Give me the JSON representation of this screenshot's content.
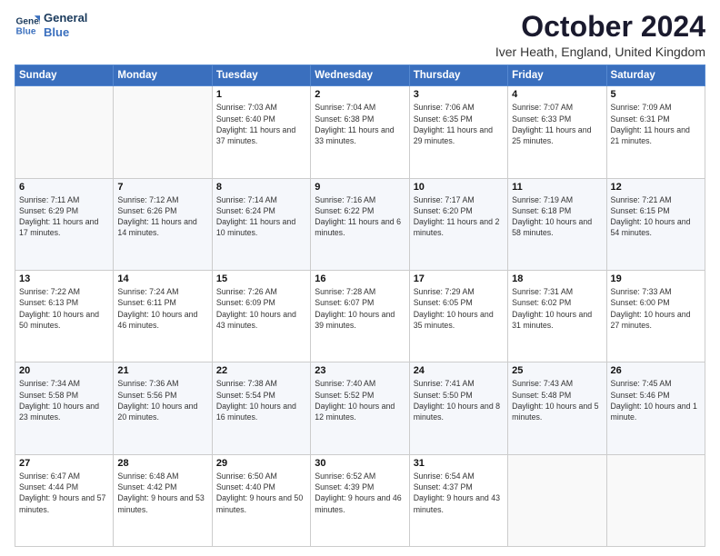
{
  "logo": {
    "line1": "General",
    "line2": "Blue"
  },
  "title": "October 2024",
  "location": "Iver Heath, England, United Kingdom",
  "days_of_week": [
    "Sunday",
    "Monday",
    "Tuesday",
    "Wednesday",
    "Thursday",
    "Friday",
    "Saturday"
  ],
  "weeks": [
    [
      {
        "day": "",
        "sunrise": "",
        "sunset": "",
        "daylight": ""
      },
      {
        "day": "",
        "sunrise": "",
        "sunset": "",
        "daylight": ""
      },
      {
        "day": "1",
        "sunrise": "Sunrise: 7:03 AM",
        "sunset": "Sunset: 6:40 PM",
        "daylight": "Daylight: 11 hours and 37 minutes."
      },
      {
        "day": "2",
        "sunrise": "Sunrise: 7:04 AM",
        "sunset": "Sunset: 6:38 PM",
        "daylight": "Daylight: 11 hours and 33 minutes."
      },
      {
        "day": "3",
        "sunrise": "Sunrise: 7:06 AM",
        "sunset": "Sunset: 6:35 PM",
        "daylight": "Daylight: 11 hours and 29 minutes."
      },
      {
        "day": "4",
        "sunrise": "Sunrise: 7:07 AM",
        "sunset": "Sunset: 6:33 PM",
        "daylight": "Daylight: 11 hours and 25 minutes."
      },
      {
        "day": "5",
        "sunrise": "Sunrise: 7:09 AM",
        "sunset": "Sunset: 6:31 PM",
        "daylight": "Daylight: 11 hours and 21 minutes."
      }
    ],
    [
      {
        "day": "6",
        "sunrise": "Sunrise: 7:11 AM",
        "sunset": "Sunset: 6:29 PM",
        "daylight": "Daylight: 11 hours and 17 minutes."
      },
      {
        "day": "7",
        "sunrise": "Sunrise: 7:12 AM",
        "sunset": "Sunset: 6:26 PM",
        "daylight": "Daylight: 11 hours and 14 minutes."
      },
      {
        "day": "8",
        "sunrise": "Sunrise: 7:14 AM",
        "sunset": "Sunset: 6:24 PM",
        "daylight": "Daylight: 11 hours and 10 minutes."
      },
      {
        "day": "9",
        "sunrise": "Sunrise: 7:16 AM",
        "sunset": "Sunset: 6:22 PM",
        "daylight": "Daylight: 11 hours and 6 minutes."
      },
      {
        "day": "10",
        "sunrise": "Sunrise: 7:17 AM",
        "sunset": "Sunset: 6:20 PM",
        "daylight": "Daylight: 11 hours and 2 minutes."
      },
      {
        "day": "11",
        "sunrise": "Sunrise: 7:19 AM",
        "sunset": "Sunset: 6:18 PM",
        "daylight": "Daylight: 10 hours and 58 minutes."
      },
      {
        "day": "12",
        "sunrise": "Sunrise: 7:21 AM",
        "sunset": "Sunset: 6:15 PM",
        "daylight": "Daylight: 10 hours and 54 minutes."
      }
    ],
    [
      {
        "day": "13",
        "sunrise": "Sunrise: 7:22 AM",
        "sunset": "Sunset: 6:13 PM",
        "daylight": "Daylight: 10 hours and 50 minutes."
      },
      {
        "day": "14",
        "sunrise": "Sunrise: 7:24 AM",
        "sunset": "Sunset: 6:11 PM",
        "daylight": "Daylight: 10 hours and 46 minutes."
      },
      {
        "day": "15",
        "sunrise": "Sunrise: 7:26 AM",
        "sunset": "Sunset: 6:09 PM",
        "daylight": "Daylight: 10 hours and 43 minutes."
      },
      {
        "day": "16",
        "sunrise": "Sunrise: 7:28 AM",
        "sunset": "Sunset: 6:07 PM",
        "daylight": "Daylight: 10 hours and 39 minutes."
      },
      {
        "day": "17",
        "sunrise": "Sunrise: 7:29 AM",
        "sunset": "Sunset: 6:05 PM",
        "daylight": "Daylight: 10 hours and 35 minutes."
      },
      {
        "day": "18",
        "sunrise": "Sunrise: 7:31 AM",
        "sunset": "Sunset: 6:02 PM",
        "daylight": "Daylight: 10 hours and 31 minutes."
      },
      {
        "day": "19",
        "sunrise": "Sunrise: 7:33 AM",
        "sunset": "Sunset: 6:00 PM",
        "daylight": "Daylight: 10 hours and 27 minutes."
      }
    ],
    [
      {
        "day": "20",
        "sunrise": "Sunrise: 7:34 AM",
        "sunset": "Sunset: 5:58 PM",
        "daylight": "Daylight: 10 hours and 23 minutes."
      },
      {
        "day": "21",
        "sunrise": "Sunrise: 7:36 AM",
        "sunset": "Sunset: 5:56 PM",
        "daylight": "Daylight: 10 hours and 20 minutes."
      },
      {
        "day": "22",
        "sunrise": "Sunrise: 7:38 AM",
        "sunset": "Sunset: 5:54 PM",
        "daylight": "Daylight: 10 hours and 16 minutes."
      },
      {
        "day": "23",
        "sunrise": "Sunrise: 7:40 AM",
        "sunset": "Sunset: 5:52 PM",
        "daylight": "Daylight: 10 hours and 12 minutes."
      },
      {
        "day": "24",
        "sunrise": "Sunrise: 7:41 AM",
        "sunset": "Sunset: 5:50 PM",
        "daylight": "Daylight: 10 hours and 8 minutes."
      },
      {
        "day": "25",
        "sunrise": "Sunrise: 7:43 AM",
        "sunset": "Sunset: 5:48 PM",
        "daylight": "Daylight: 10 hours and 5 minutes."
      },
      {
        "day": "26",
        "sunrise": "Sunrise: 7:45 AM",
        "sunset": "Sunset: 5:46 PM",
        "daylight": "Daylight: 10 hours and 1 minute."
      }
    ],
    [
      {
        "day": "27",
        "sunrise": "Sunrise: 6:47 AM",
        "sunset": "Sunset: 4:44 PM",
        "daylight": "Daylight: 9 hours and 57 minutes."
      },
      {
        "day": "28",
        "sunrise": "Sunrise: 6:48 AM",
        "sunset": "Sunset: 4:42 PM",
        "daylight": "Daylight: 9 hours and 53 minutes."
      },
      {
        "day": "29",
        "sunrise": "Sunrise: 6:50 AM",
        "sunset": "Sunset: 4:40 PM",
        "daylight": "Daylight: 9 hours and 50 minutes."
      },
      {
        "day": "30",
        "sunrise": "Sunrise: 6:52 AM",
        "sunset": "Sunset: 4:39 PM",
        "daylight": "Daylight: 9 hours and 46 minutes."
      },
      {
        "day": "31",
        "sunrise": "Sunrise: 6:54 AM",
        "sunset": "Sunset: 4:37 PM",
        "daylight": "Daylight: 9 hours and 43 minutes."
      },
      {
        "day": "",
        "sunrise": "",
        "sunset": "",
        "daylight": ""
      },
      {
        "day": "",
        "sunrise": "",
        "sunset": "",
        "daylight": ""
      }
    ]
  ]
}
